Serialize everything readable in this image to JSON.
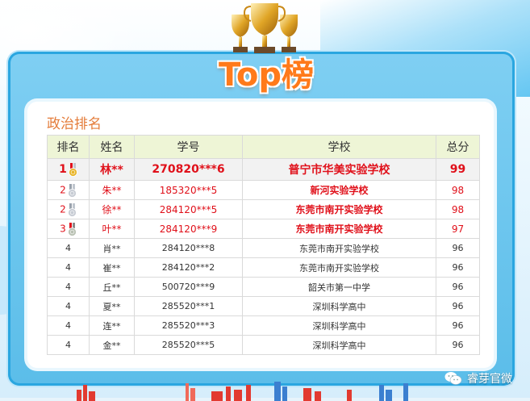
{
  "banner": {
    "title": "Top榜"
  },
  "section": {
    "title": "政治排名"
  },
  "table": {
    "headers": [
      "排名",
      "姓名",
      "学号",
      "学校",
      "总分"
    ],
    "rows": [
      {
        "rank": "1",
        "name": "林**",
        "id": "270820***6",
        "school": "普宁市华美实验学校",
        "score": "99",
        "medal": "gold"
      },
      {
        "rank": "2",
        "name": "朱**",
        "id": "185320***5",
        "school": "新河实验学校",
        "score": "98",
        "medal": "silver"
      },
      {
        "rank": "2",
        "name": "徐**",
        "id": "284120***5",
        "school": "东莞市南开实验学校",
        "score": "98",
        "medal": "silver"
      },
      {
        "rank": "3",
        "name": "叶**",
        "id": "284120***9",
        "school": "东莞市南开实验学校",
        "score": "97",
        "medal": "bronze"
      },
      {
        "rank": "4",
        "name": "肖**",
        "id": "284120***8",
        "school": "东莞市南开实验学校",
        "score": "96"
      },
      {
        "rank": "4",
        "name": "崔**",
        "id": "284120***2",
        "school": "东莞市南开实验学校",
        "score": "96"
      },
      {
        "rank": "4",
        "name": "丘**",
        "id": "500720***9",
        "school": "韶关市第一中学",
        "score": "96"
      },
      {
        "rank": "4",
        "name": "夏**",
        "id": "285520***1",
        "school": "深圳科学高中",
        "score": "96"
      },
      {
        "rank": "4",
        "name": "连**",
        "id": "285520***3",
        "school": "深圳科学高中",
        "score": "96"
      },
      {
        "rank": "4",
        "name": "金**",
        "id": "285520***5",
        "school": "深圳科学高中",
        "score": "96"
      }
    ]
  },
  "footer": {
    "brand": "睿芽官微",
    "icon": "wechat-icon"
  },
  "colors": {
    "accent": "#e0101a",
    "header_bg": "#eef5d6",
    "frame": "#2aa6e0",
    "title_orange": "#ff7a1a"
  }
}
